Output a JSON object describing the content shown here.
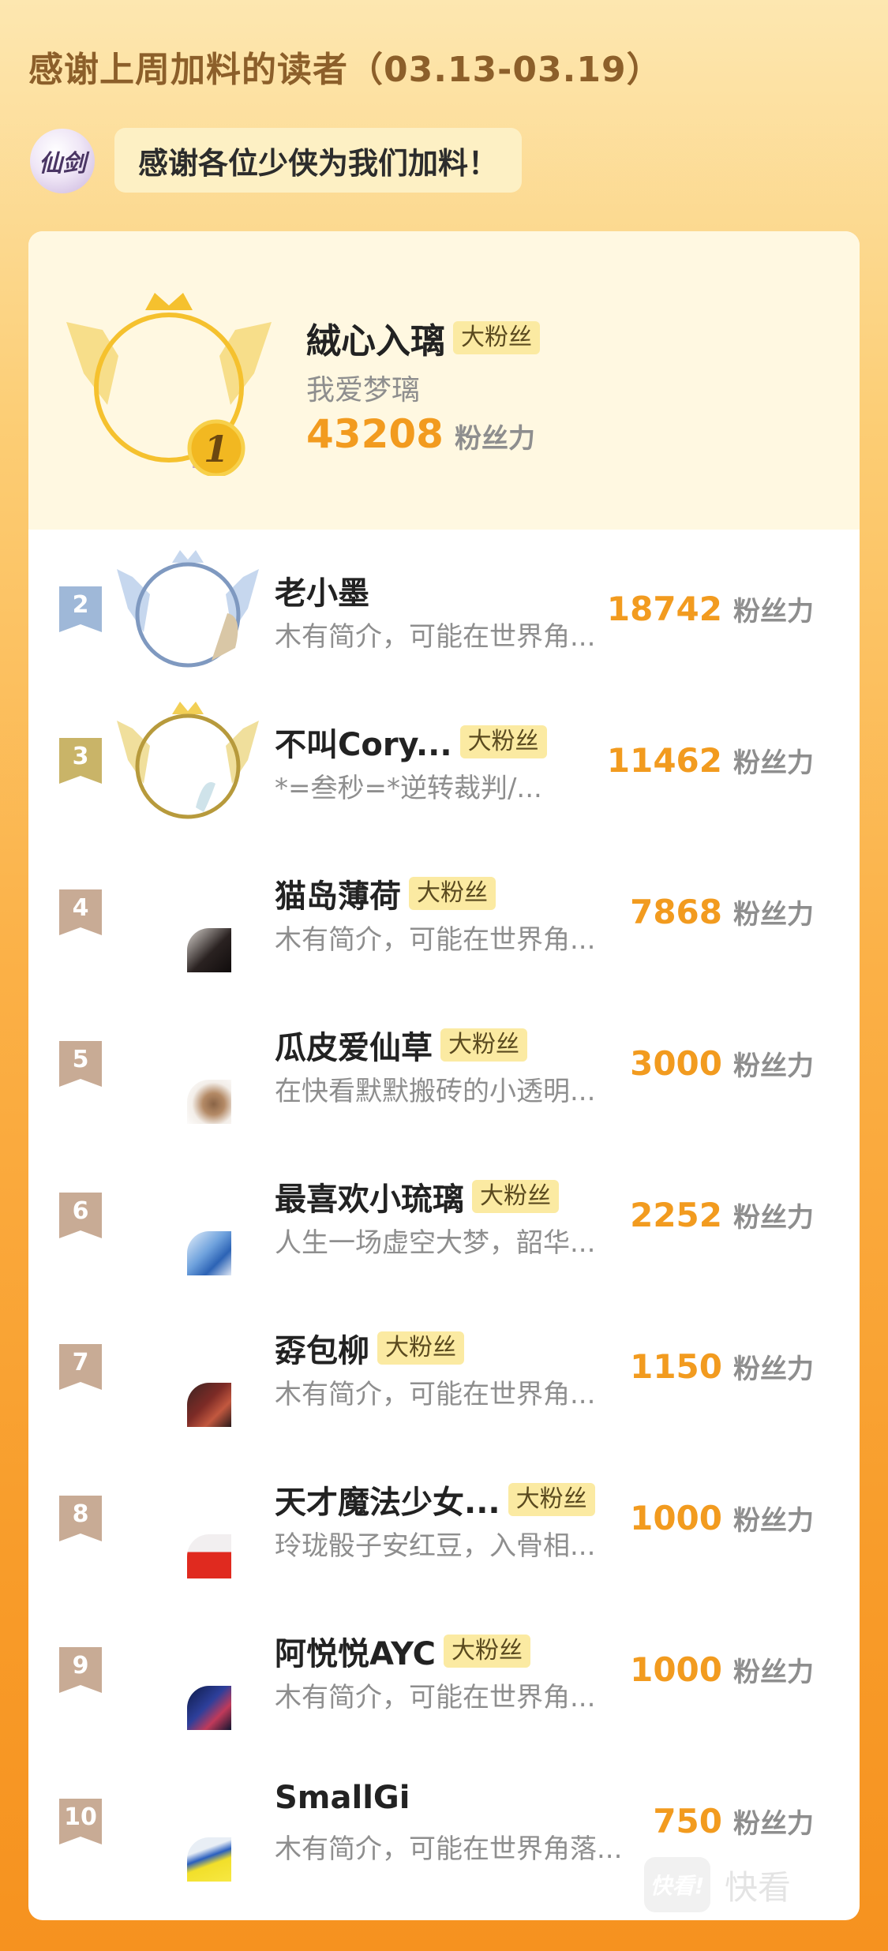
{
  "header": {
    "title": "感谢上周加料的读者（03.13-03.19）",
    "avatar_text": "仙剑",
    "thanks_text": "感谢各位少侠为我们加料！"
  },
  "top1": {
    "rank": "1",
    "name": "絨心入璃",
    "badge": "大粉丝",
    "bio": "我爱梦璃",
    "score": "43208",
    "unit": "粉丝力"
  },
  "rows": [
    {
      "rank": "2",
      "name": "老小墨",
      "badge": "",
      "bio": "木有简介，可能在世界角...",
      "score": "18742",
      "unit": "粉丝力"
    },
    {
      "rank": "3",
      "name": "不叫Cory...",
      "badge": "大粉丝",
      "bio": "*=叁秒=*逆转裁判/...",
      "score": "11462",
      "unit": "粉丝力"
    },
    {
      "rank": "4",
      "name": "猫岛薄荷",
      "badge": "大粉丝",
      "bio": "木有简介，可能在世界角...",
      "score": "7868",
      "unit": "粉丝力"
    },
    {
      "rank": "5",
      "name": "瓜皮爱仙草",
      "badge": "大粉丝",
      "bio": "在快看默默搬砖的小透明...",
      "score": "3000",
      "unit": "粉丝力"
    },
    {
      "rank": "6",
      "name": "最喜欢小琉璃",
      "badge": "大粉丝",
      "bio": "人生一场虚空大梦，韶华...",
      "score": "2252",
      "unit": "粉丝力"
    },
    {
      "rank": "7",
      "name": "孬包柳",
      "badge": "大粉丝",
      "bio": "木有简介，可能在世界角...",
      "score": "1150",
      "unit": "粉丝力"
    },
    {
      "rank": "8",
      "name": "天才魔法少女...",
      "badge": "大粉丝",
      "bio": "玲珑骰子安红豆，入骨相...",
      "score": "1000",
      "unit": "粉丝力"
    },
    {
      "rank": "9",
      "name": "阿悦悦AYC",
      "badge": "大粉丝",
      "bio": "木有简介，可能在世界角...",
      "score": "1000",
      "unit": "粉丝力"
    },
    {
      "rank": "10",
      "name": "SmallGi",
      "badge": "",
      "bio": "木有简介，可能在世界角落...",
      "score": "750",
      "unit": "粉丝力"
    }
  ],
  "watermark": {
    "logo_text": "快看!",
    "text": "快看"
  },
  "colors": {
    "score": "#f29b1f",
    "rank_gold": "#f0b41f",
    "rank_silver": "#9fb8d8",
    "rank_bronze": "#c9b468",
    "rank_plain": "#c8ab95"
  }
}
